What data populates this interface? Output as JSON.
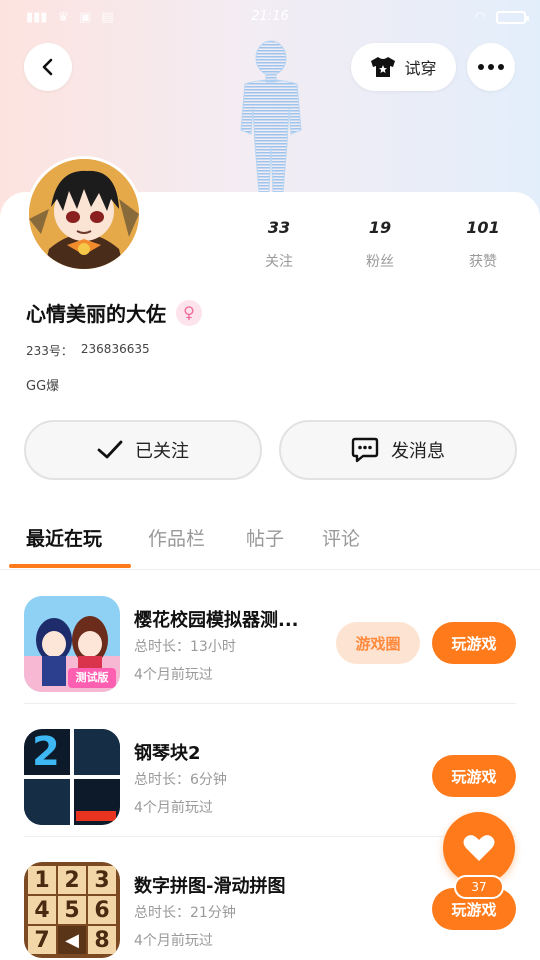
{
  "status_bar": {
    "time": "21:16"
  },
  "header": {
    "wardrobe_label": "试穿"
  },
  "profile": {
    "nickname": "心情美丽的大佐",
    "uid_label": "233号：",
    "uid_value": "236836635",
    "bio": "GG爆",
    "stats": [
      {
        "value": "33",
        "label": "关注"
      },
      {
        "value": "19",
        "label": "粉丝"
      },
      {
        "value": "101",
        "label": "获赞"
      }
    ]
  },
  "actions": {
    "follow_label": "已关注",
    "message_label": "发消息"
  },
  "tabs": [
    {
      "label": "最近在玩"
    },
    {
      "label": "作品栏"
    },
    {
      "label": "帖子"
    },
    {
      "label": "评论"
    }
  ],
  "games": [
    {
      "name": "樱花校园模拟器测...",
      "duration": "总时长：13小时",
      "last_played": "4个月前玩过",
      "circle_label": "游戏圈",
      "play_label": "玩游戏",
      "icon": "sakura-school-icon"
    },
    {
      "name": "钢琴块2",
      "duration": "总时长：6分钟",
      "last_played": "4个月前玩过",
      "play_label": "玩游戏",
      "icon": "piano-tiles-icon"
    },
    {
      "name": "数字拼图-滑动拼图",
      "duration": "总时长：21分钟",
      "last_played": "4个月前玩过",
      "play_label": "玩游戏",
      "icon": "number-puzzle-icon"
    }
  ],
  "sakura_icon_badge": "测试版",
  "piano_icon_number": "2",
  "puzzle_tiles": [
    "1",
    "2",
    "3",
    "4",
    "5",
    "6",
    "7",
    "",
    "8"
  ],
  "like_fab": {
    "count": "37"
  },
  "colors": {
    "accent": "#ff7a1a",
    "accent_light": "#fde4d2",
    "gender": "#f06c9b"
  }
}
